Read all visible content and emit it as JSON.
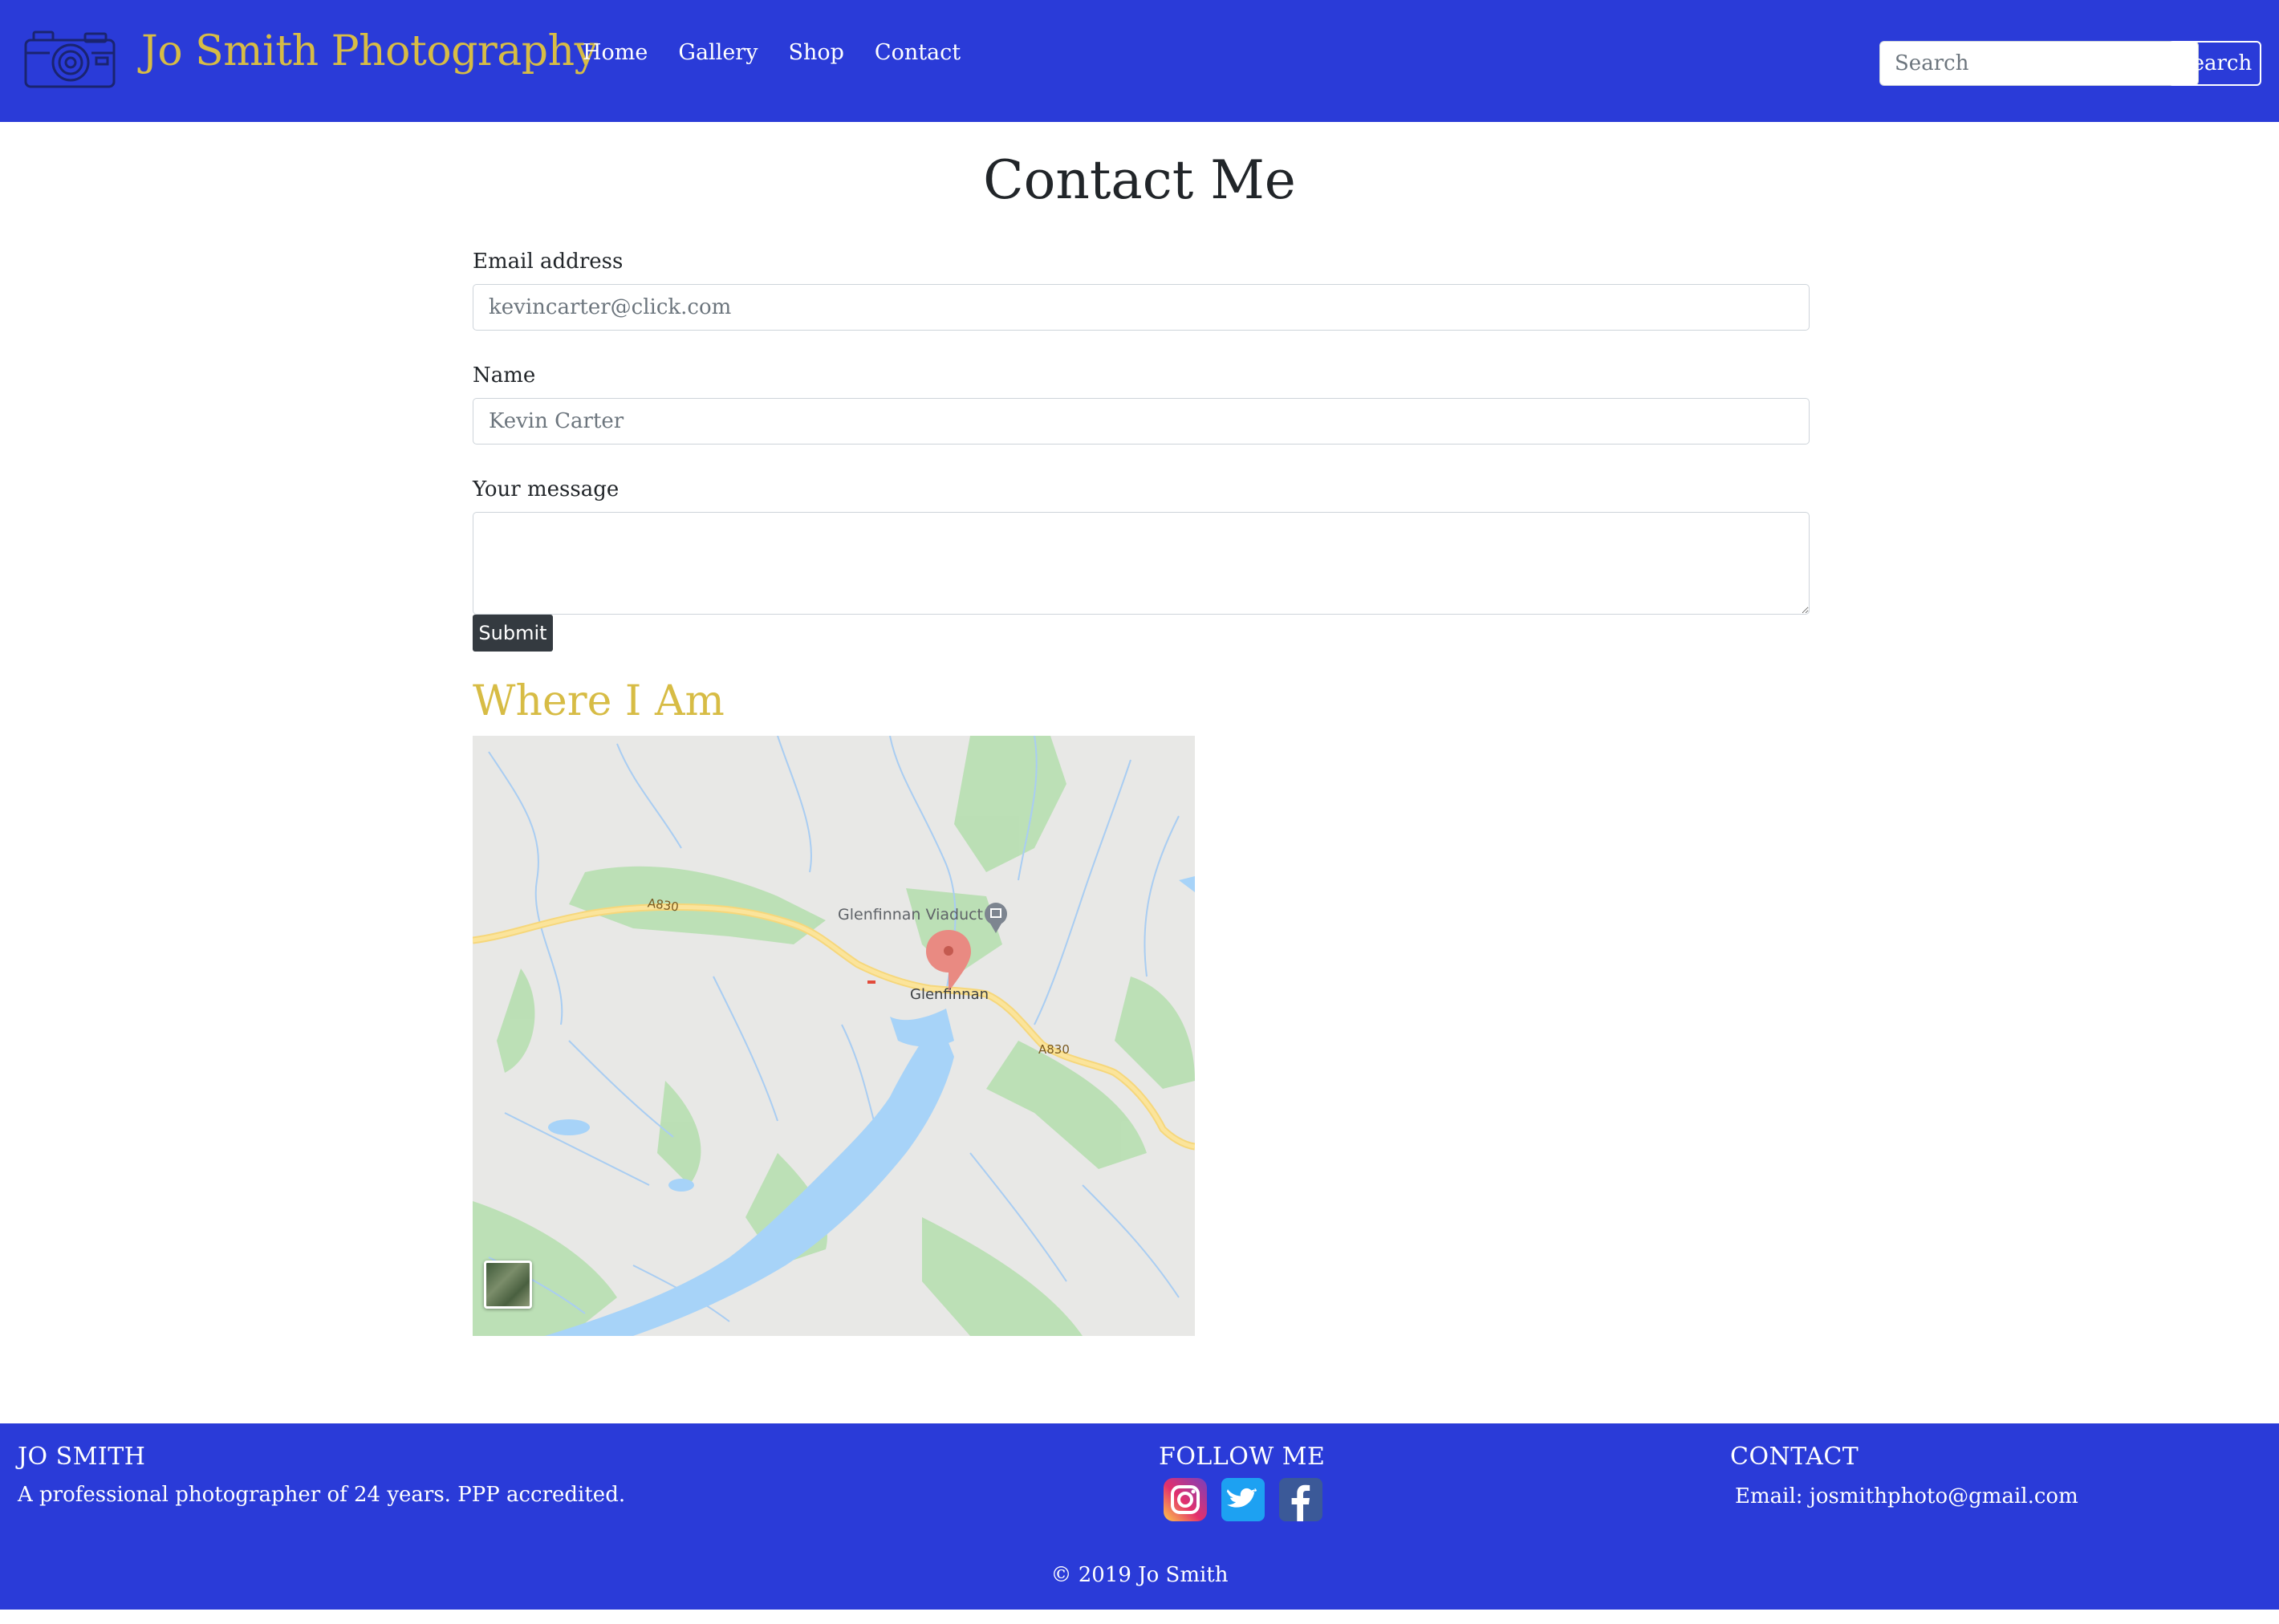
{
  "navbar": {
    "brand": "Jo Smith Photography",
    "links": [
      "Home",
      "Gallery",
      "Shop",
      "Contact"
    ],
    "search_placeholder": "Search",
    "search_button": "Search",
    "logo_icon": "camera-icon",
    "background": "#2a3bd8",
    "brand_color": "#d7bc45"
  },
  "main": {
    "title": "Contact Me",
    "form": {
      "email_label": "Email address",
      "email_placeholder": "kevincarter@click.com",
      "name_label": "Name",
      "name_placeholder": "Kevin Carter",
      "message_label": "Your message",
      "message_value": "",
      "submit_label": "Submit"
    },
    "map_section": {
      "title": "Where I Am",
      "labels": {
        "road_a830": "A830",
        "viaduct": "Glenfinnan Viaduct",
        "town": "Glenfinnan"
      }
    }
  },
  "footer": {
    "about_heading": "JO SMITH",
    "about_text": "A professional photographer of 24 years. PPP accredited.",
    "follow_heading": "FOLLOW ME",
    "social_icons": [
      "instagram-icon",
      "twitter-icon",
      "facebook-icon"
    ],
    "contact_heading": "CONTACT",
    "contact_email": "Email: josmithphoto@gmail.com",
    "copyright": "© 2019 Jo Smith"
  }
}
